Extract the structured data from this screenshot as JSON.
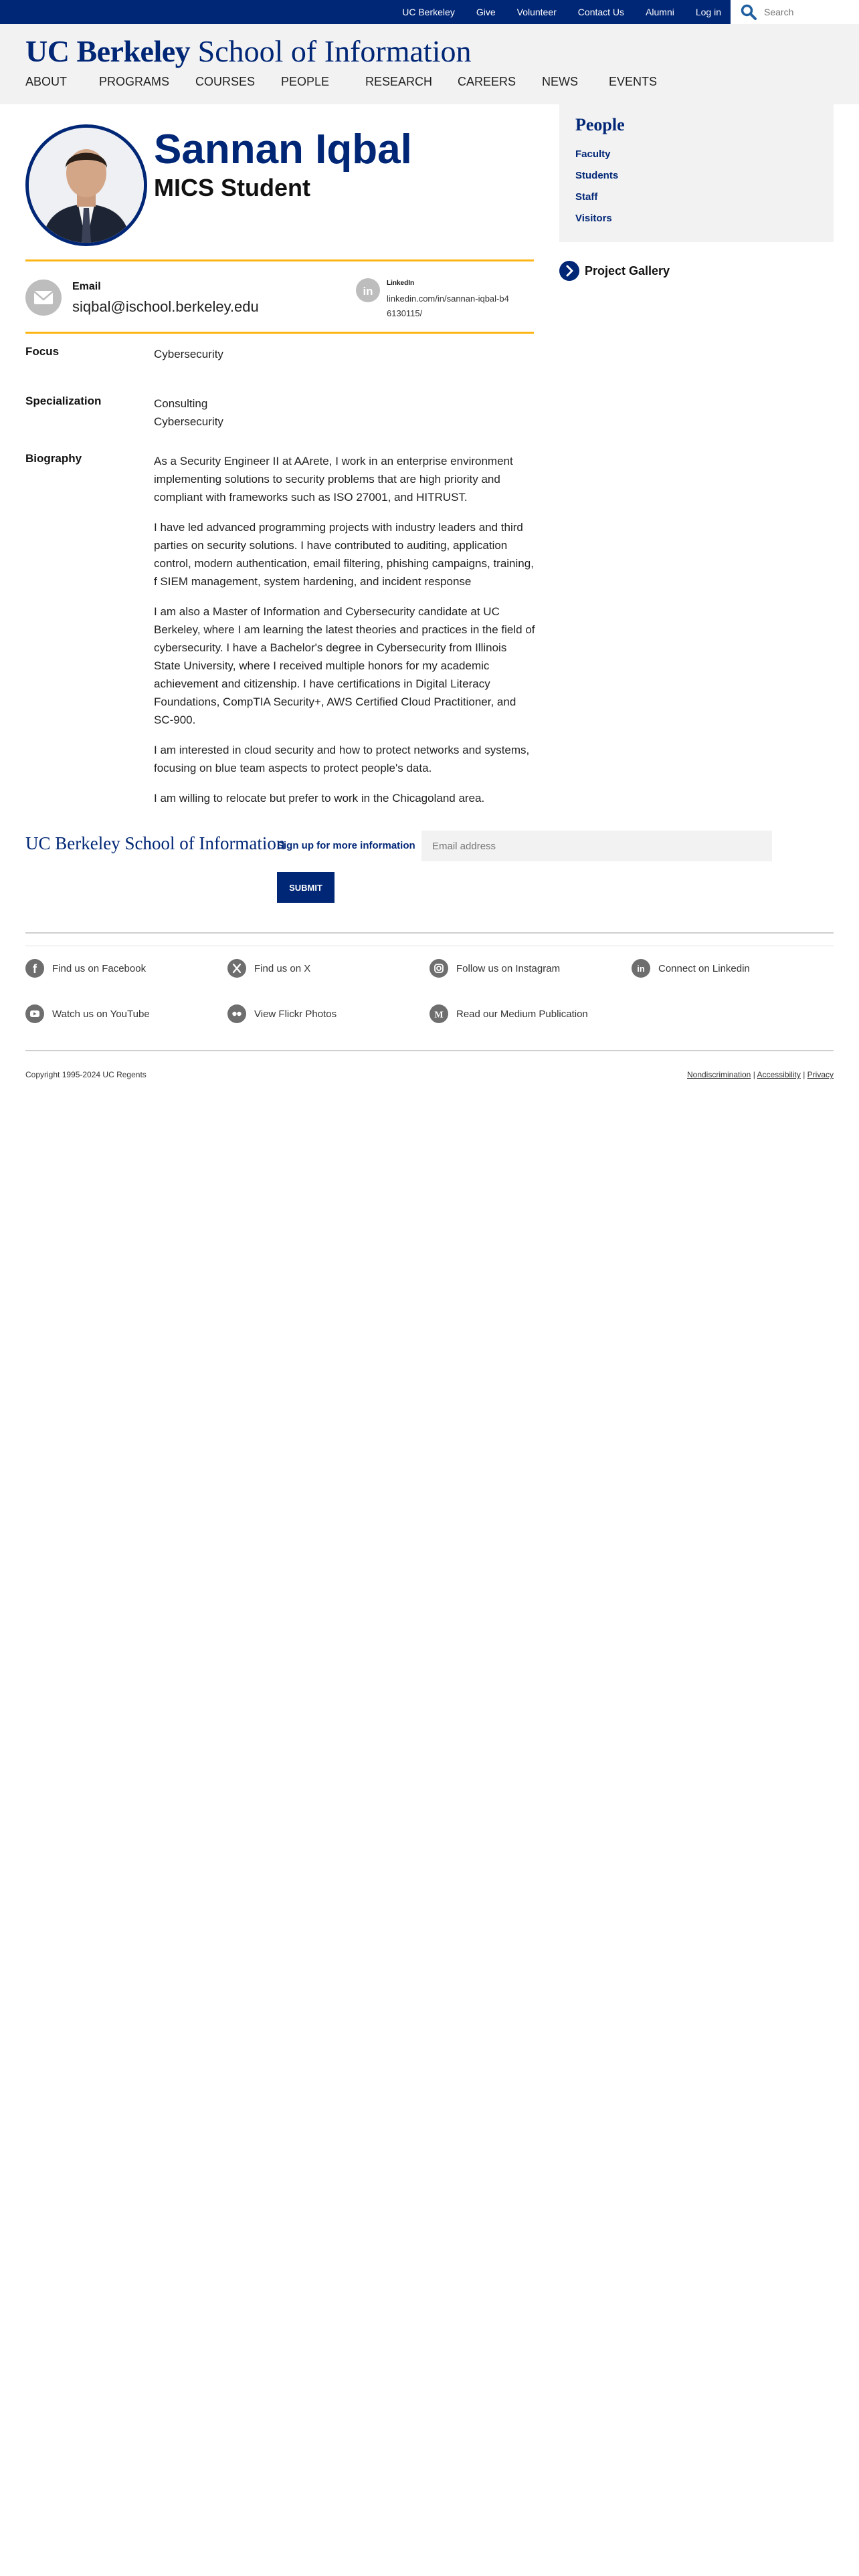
{
  "topbar": {
    "links": [
      "UC Berkeley",
      "Give",
      "Volunteer",
      "Contact Us",
      "Alumni",
      "Log in"
    ],
    "search_placeholder": "Search"
  },
  "header": {
    "logo_bold": "UC Berkeley",
    "logo_rest": "School of Information",
    "nav": [
      "ABOUT",
      "PROGRAMS",
      "COURSES",
      "PEOPLE",
      "RESEARCH",
      "CAREERS",
      "NEWS",
      "EVENTS"
    ]
  },
  "profile": {
    "name": "Sannan Iqbal",
    "role": "MICS Student",
    "email_label": "Email",
    "email": "siqbal@ischool.berkeley.edu",
    "linkedin_label": "LinkedIn",
    "linkedin": "linkedin.com/in/sannan-iqbal-b46130115/",
    "focus_label": "Focus",
    "focus": "Cybersecurity",
    "specialization_label": "Specialization",
    "specializations": [
      "Consulting",
      "Cybersecurity"
    ],
    "biography_label": "Biography",
    "biography": [
      "As a Security Engineer II at AArete, I work in an enterprise environment implementing solutions to security problems that are high priority and compliant with frameworks such as ISO 27001, and HITRUST.",
      "I have led advanced programming projects with industry leaders and third parties on security solutions. I have contributed to auditing, application control, modern authentication, email filtering, phishing campaigns, training, f SIEM management, system hardening, and incident response",
      "I am also a Master of Information and Cybersecurity candidate at UC Berkeley, where I am learning the latest theories and practices in the field of cybersecurity. I have a Bachelor's degree in Cybersecurity from Illinois State University, where I received multiple honors for my academic achievement and citizenship. I have certifications in Digital Literacy Foundations, CompTIA Security+, AWS Certified Cloud Practitioner, and SC-900.",
      "I am interested in cloud security and how to protect networks and systems, focusing on blue team aspects to protect people's data.",
      "I am willing to relocate but prefer to work in the Chicagoland area."
    ]
  },
  "sidebar": {
    "title": "People",
    "items": [
      "Faculty",
      "Students",
      "Staff",
      "Visitors"
    ],
    "gallery": "Project Gallery"
  },
  "footer": {
    "logo_bold": "UC Berkeley",
    "logo_rest": "School of Information",
    "signup_label": "Sign up for more information",
    "email_placeholder": "Email address",
    "submit": "SUBMIT",
    "social": [
      {
        "label": "Find us on Facebook",
        "icon": "facebook-icon"
      },
      {
        "label": "Find us on X",
        "icon": "x-icon"
      },
      {
        "label": "Follow us on Instagram",
        "icon": "instagram-icon"
      },
      {
        "label": "Connect on Linkedin",
        "icon": "linkedin-icon"
      },
      {
        "label": "Watch us on YouTube",
        "icon": "youtube-icon"
      },
      {
        "label": "View Flickr Photos",
        "icon": "flickr-icon"
      },
      {
        "label": "Read our Medium Publication",
        "icon": "medium-icon"
      }
    ],
    "copyright": "Copyright 1995-2024 UC Regents",
    "legal": [
      "Nondiscrimination",
      "Accessibility",
      "Privacy"
    ]
  },
  "colors": {
    "berkeley_blue": "#002676",
    "california_gold": "#fdb515",
    "header_gray": "#f2f2f2",
    "icon_gray": "#bdbdbd"
  }
}
